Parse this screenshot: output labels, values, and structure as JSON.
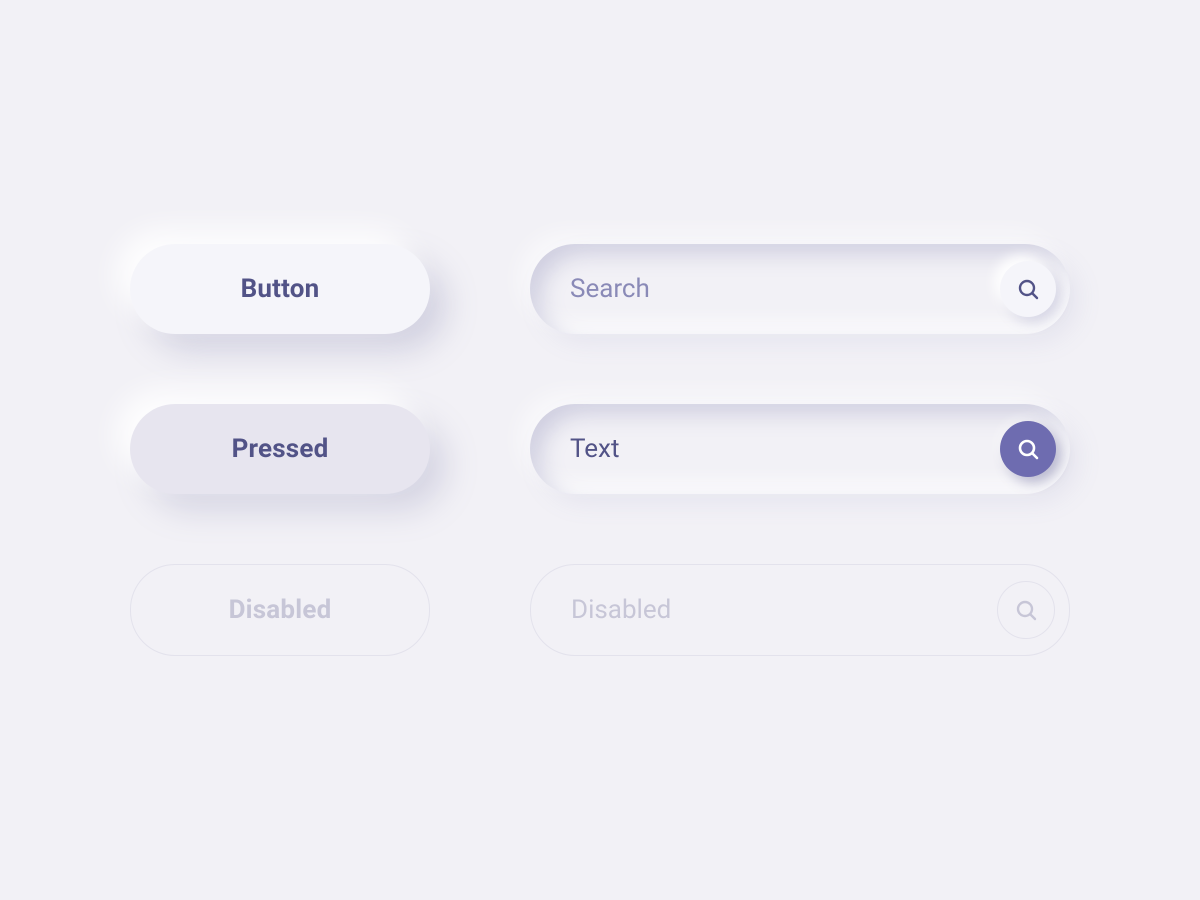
{
  "buttons": {
    "default_label": "Button",
    "pressed_label": "Pressed",
    "disabled_label": "Disabled"
  },
  "search": {
    "placeholder": "Search",
    "filled_value": "Text",
    "disabled_placeholder": "Disabled"
  },
  "colors": {
    "background": "#F2F1F6",
    "accent": "#6E6CB0",
    "text_primary": "#525387",
    "text_muted": "#8A8AB7",
    "text_disabled": "#C7C6D7"
  }
}
